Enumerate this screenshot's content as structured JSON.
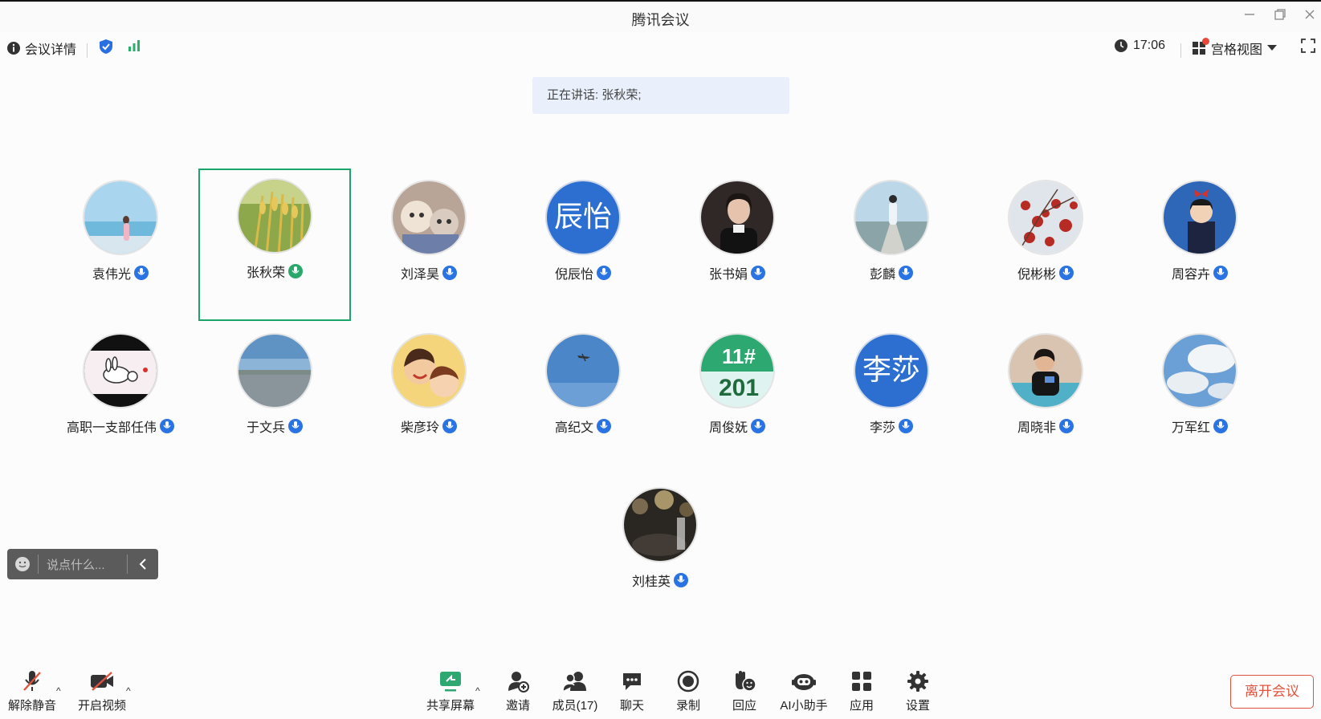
{
  "window": {
    "title": "腾讯会议"
  },
  "infobar": {
    "details_label": "会议详情",
    "time": "17:06",
    "view_label": "宫格视图"
  },
  "speaking": {
    "text": "正在讲话: 张秋荣;"
  },
  "participants": [
    {
      "name": "袁伟光",
      "avatar": "photo-beach"
    },
    {
      "name": "张秋荣",
      "avatar": "photo-rice",
      "active": true
    },
    {
      "name": "刘泽昊",
      "avatar": "photo-cats"
    },
    {
      "name": "倪辰怡",
      "avatar_text": "辰怡"
    },
    {
      "name": "张书娟",
      "avatar": "photo-woman"
    },
    {
      "name": "彭麟",
      "avatar": "photo-street"
    },
    {
      "name": "倪彬彬",
      "avatar": "photo-redtree"
    },
    {
      "name": "周容卉",
      "avatar": "photo-anime-witch"
    },
    {
      "name": "高职一支部任伟",
      "avatar": "photo-rabbit"
    },
    {
      "name": "于文兵",
      "avatar": "photo-lake"
    },
    {
      "name": "柴彦玲",
      "avatar": "photo-anime-kids"
    },
    {
      "name": "高纪文",
      "avatar": "photo-sky-plane"
    },
    {
      "name": "周俊妩",
      "avatar_text": "11# 201"
    },
    {
      "name": "李莎",
      "avatar_text": "李莎"
    },
    {
      "name": "周晓非",
      "avatar": "photo-woman-phone"
    },
    {
      "name": "万军红",
      "avatar": "photo-clouds"
    },
    {
      "name": "刘桂英",
      "avatar": "photo-dark-glass"
    }
  ],
  "chat": {
    "placeholder": "说点什么..."
  },
  "toolbar": {
    "unmute": "解除静音",
    "video": "开启视频",
    "share": "共享屏幕",
    "invite": "邀请",
    "members": "成员(17)",
    "chat": "聊天",
    "record": "录制",
    "react": "回应",
    "ai": "AI小助手",
    "apps": "应用",
    "settings": "设置",
    "leave": "离开会议"
  },
  "colors": {
    "accent": "#2a73e3",
    "active_border": "#1aa66b",
    "leave": "#e0533d"
  }
}
